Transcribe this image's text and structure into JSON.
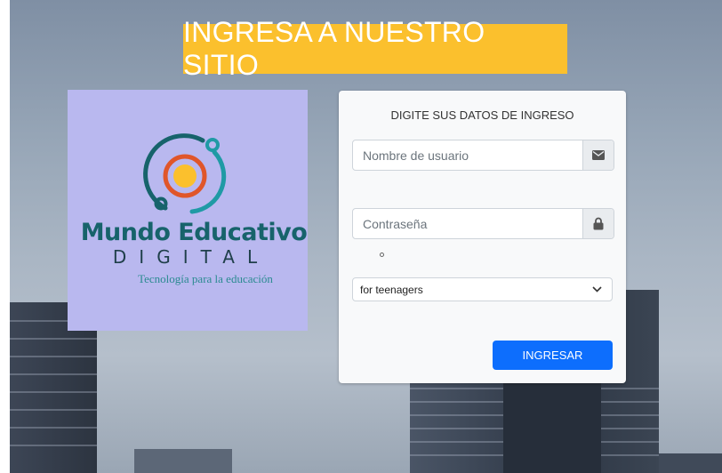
{
  "banner": {
    "title": "INGRESA A NUESTRO SITIO"
  },
  "logo": {
    "name": "Mundo Educativo",
    "subname": "DIGITAL",
    "tagline": "Tecnología para la educación"
  },
  "login": {
    "heading": "DIGITE SUS DATOS DE INGRESO",
    "username_placeholder": "Nombre de usuario",
    "username_icon": "envelope-icon",
    "password_placeholder": "Contraseña",
    "password_icon": "lock-icon",
    "select_value": "for teenagers",
    "submit_label": "INGRESAR"
  },
  "colors": {
    "banner_bg": "#fbc02d",
    "logo_bg": "#b9b8ef",
    "button_bg": "#0d6efd",
    "logo_teal": "#17636b"
  }
}
